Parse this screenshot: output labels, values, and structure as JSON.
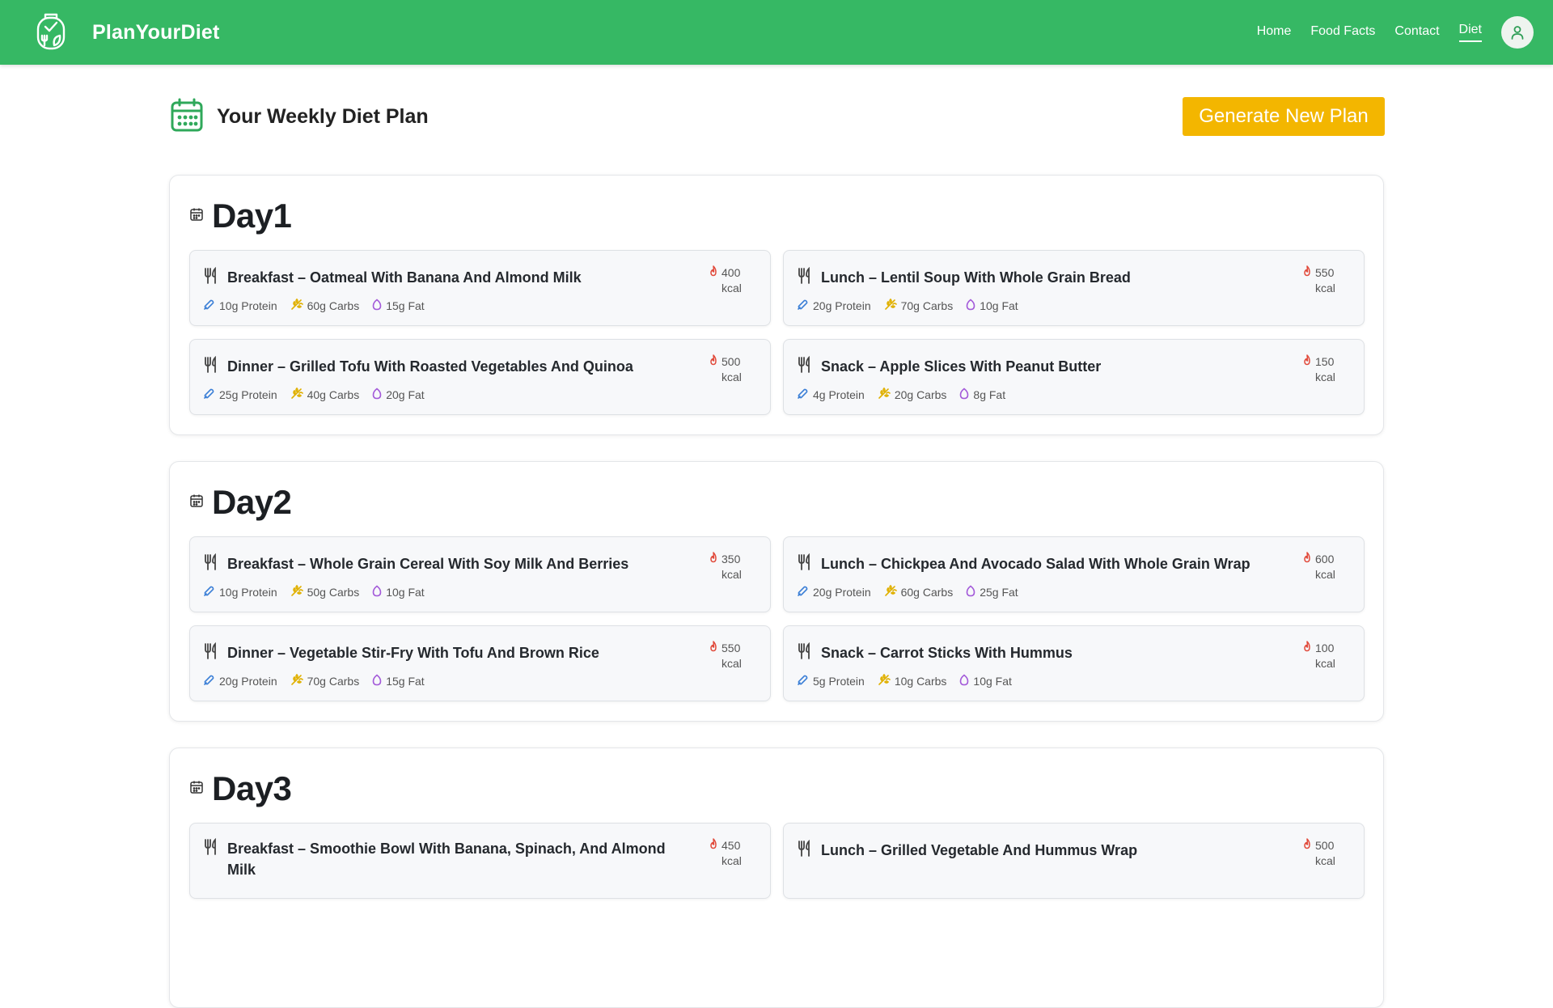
{
  "app": {
    "brand": "PlanYourDiet"
  },
  "nav": {
    "links": [
      "Home",
      "Food Facts",
      "Contact",
      "Diet"
    ],
    "active": "Diet"
  },
  "page": {
    "title": "Your Weekly Diet Plan",
    "generate_button": "Generate New Plan"
  },
  "colors": {
    "header": "#36b864",
    "accent_button": "#f3b600",
    "protein_icon": "#3b7fd6",
    "carbs_icon": "#e0b000",
    "fat_icon": "#a35ad9",
    "kcal_icon": "#e14a3b"
  },
  "days": [
    {
      "title": "Day1",
      "meals": [
        {
          "title": "Breakfast – Oatmeal With Banana And Almond Milk",
          "kcal": "400 kcal",
          "protein": "10g Protein",
          "carbs": "60g Carbs",
          "fat": "15g Fat"
        },
        {
          "title": "Lunch – Lentil Soup With Whole Grain Bread",
          "kcal": "550 kcal",
          "protein": "20g Protein",
          "carbs": "70g Carbs",
          "fat": "10g Fat"
        },
        {
          "title": "Dinner – Grilled Tofu With Roasted Vegetables And Quinoa",
          "kcal": "500 kcal",
          "protein": "25g Protein",
          "carbs": "40g Carbs",
          "fat": "20g Fat"
        },
        {
          "title": "Snack – Apple Slices With Peanut Butter",
          "kcal": "150 kcal",
          "protein": "4g Protein",
          "carbs": "20g Carbs",
          "fat": "8g Fat"
        }
      ]
    },
    {
      "title": "Day2",
      "meals": [
        {
          "title": "Breakfast – Whole Grain Cereal With Soy Milk And Berries",
          "kcal": "350 kcal",
          "protein": "10g Protein",
          "carbs": "50g Carbs",
          "fat": "10g Fat"
        },
        {
          "title": "Lunch – Chickpea And Avocado Salad With Whole Grain Wrap",
          "kcal": "600 kcal",
          "protein": "20g Protein",
          "carbs": "60g Carbs",
          "fat": "25g Fat"
        },
        {
          "title": "Dinner – Vegetable Stir-Fry With Tofu And Brown Rice",
          "kcal": "550 kcal",
          "protein": "20g Protein",
          "carbs": "70g Carbs",
          "fat": "15g Fat"
        },
        {
          "title": "Snack – Carrot Sticks With Hummus",
          "kcal": "100 kcal",
          "protein": "5g Protein",
          "carbs": "10g Carbs",
          "fat": "10g Fat"
        }
      ]
    },
    {
      "title": "Day3",
      "meals": [
        {
          "title": "Breakfast – Smoothie Bowl With Banana, Spinach, And Almond Milk",
          "kcal": "450 kcal"
        },
        {
          "title": "Lunch – Grilled Vegetable And Hummus Wrap",
          "kcal": "500 kcal"
        }
      ]
    }
  ]
}
